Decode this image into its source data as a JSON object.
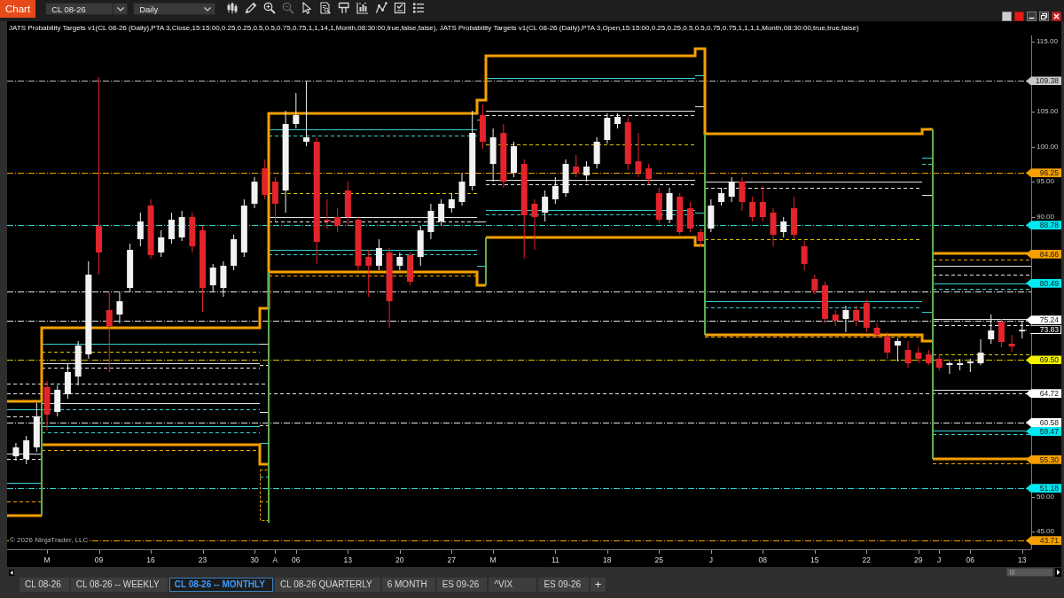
{
  "window": {
    "title": "Chart"
  },
  "toolbar": {
    "instrument": "CL 08-26",
    "interval": "Daily",
    "tools": [
      {
        "kind": "candles",
        "disabled": false
      },
      {
        "kind": "pencil",
        "disabled": false
      },
      {
        "kind": "zoom_in",
        "disabled": false
      },
      {
        "kind": "zoom_out",
        "disabled": true
      },
      {
        "kind": "pointer",
        "disabled": false
      },
      {
        "kind": "properties",
        "disabled": false
      },
      {
        "kind": "flag",
        "disabled": false
      },
      {
        "kind": "indicators",
        "disabled": false
      },
      {
        "kind": "strategies",
        "disabled": false
      },
      {
        "kind": "checklist",
        "disabled": false
      },
      {
        "kind": "list",
        "disabled": false
      }
    ]
  },
  "chart": {
    "legend": "JATS Probability Targets v1(CL 08-26 (Daily),PTA 3,Close,15:15:00,0.25,0.25,0.5,0.5,0.75,0.75,1,1,14,1,Month,08:30:00,true,false,false), JATS Probability Targets v1(CL 08-26 (Daily),PTA 3,Open,15:15:00,0.25,0.25,0.5,0.5,0.75,0.75,1,1,1,1,Month,08:30:00,true,true,false)",
    "chart_data": {
      "type": "candlestick",
      "categories": [
        null,
        null,
        null,
        "M",
        null,
        null,
        null,
        null,
        "09",
        null,
        null,
        null,
        null,
        "16",
        null,
        null,
        null,
        null,
        "23",
        null,
        null,
        null,
        null,
        "30",
        null,
        "A",
        null,
        "06",
        null,
        null,
        null,
        null,
        "13",
        null,
        null,
        null,
        null,
        "20",
        null,
        null,
        null,
        null,
        "27",
        null,
        null,
        null,
        "M",
        null,
        null,
        null,
        null,
        null,
        "11",
        null,
        null,
        null,
        null,
        "18",
        null,
        null,
        null,
        null,
        "25",
        null,
        null,
        null,
        null,
        "J",
        null,
        null,
        null,
        null,
        "08",
        null,
        null,
        null,
        null,
        "15",
        null,
        null,
        null,
        null,
        "22",
        null,
        null,
        null,
        null,
        "29",
        null,
        "J",
        null,
        null,
        "06",
        null,
        null,
        null,
        null,
        "13"
      ],
      "ohlc": [
        [
          55.76,
          57.66,
          55.13,
          57.03
        ],
        [
          55.38,
          58.67,
          54.62,
          58.04
        ],
        [
          57.03,
          63.36,
          56.39,
          61.46
        ],
        [
          65.64,
          66.52,
          59.56,
          61.71
        ],
        [
          62.09,
          65.89,
          61.46,
          65.26
        ],
        [
          64.62,
          69.05,
          63.99,
          67.79
        ],
        [
          67.15,
          72.22,
          65.89,
          71.58
        ],
        [
          70.32,
          83.61,
          69.69,
          81.71
        ],
        [
          88.67,
          109.94,
          81.71,
          84.88
        ],
        [
          76.65,
          79.18,
          67.79,
          74.37
        ],
        [
          76.01,
          79.18,
          74.75,
          77.91
        ],
        [
          79.81,
          86.14,
          79.18,
          85.25
        ],
        [
          86.77,
          90.57,
          85.76,
          89.31
        ],
        [
          91.58,
          92.47,
          83.99,
          84.5
        ],
        [
          84.88,
          88.04,
          84.24,
          87.03
        ],
        [
          86.77,
          90.57,
          86.14,
          89.56
        ],
        [
          87.03,
          90.82,
          86.52,
          89.94
        ],
        [
          89.94,
          90.57,
          84.88,
          85.76
        ],
        [
          88.04,
          88.67,
          76.39,
          79.81
        ],
        [
          80.19,
          83.23,
          79.18,
          82.72
        ],
        [
          79.81,
          83.61,
          78.55,
          82.98
        ],
        [
          82.98,
          87.41,
          82.34,
          86.77
        ],
        [
          84.88,
          92.47,
          84.24,
          91.58
        ],
        [
          91.84,
          95.63,
          91.2,
          95.0
        ],
        [
          96.9,
          98.17,
          92.47,
          93.1
        ],
        [
          95.0,
          95.63,
          89.31,
          91.84
        ],
        [
          93.74,
          105.13,
          90.57,
          103.23
        ],
        [
          103.23,
          107.66,
          102.6,
          104.5
        ],
        [
          100.7,
          109.31,
          100.06,
          101.33
        ],
        [
          100.7,
          101.33,
          83.23,
          86.39
        ],
        [
          89.56,
          92.47,
          88.29,
          89.31
        ],
        [
          89.94,
          91.2,
          87.79,
          88.67
        ],
        [
          93.74,
          95.0,
          88.67,
          89.94
        ],
        [
          89.56,
          89.94,
          82.34,
          82.98
        ],
        [
          84.24,
          85.25,
          78.55,
          82.98
        ],
        [
          82.98,
          86.77,
          82.34,
          85.51
        ],
        [
          84.88,
          85.51,
          74.12,
          77.91
        ],
        [
          82.98,
          84.88,
          82.34,
          84.24
        ],
        [
          84.5,
          84.88,
          80.19,
          80.7
        ],
        [
          84.24,
          88.67,
          82.98,
          88.04
        ],
        [
          87.79,
          91.84,
          86.77,
          90.82
        ],
        [
          89.31,
          92.47,
          88.67,
          91.84
        ],
        [
          91.2,
          93.36,
          90.57,
          92.47
        ],
        [
          92.09,
          96.27,
          91.58,
          95.0
        ],
        [
          94.37,
          105.13,
          93.74,
          101.96
        ],
        [
          104.5,
          106.01,
          99.69,
          100.7
        ],
        [
          97.53,
          102.6,
          95.0,
          101.33
        ],
        [
          101.96,
          103.23,
          94.12,
          95.0
        ],
        [
          96.27,
          100.7,
          95.63,
          100.06
        ],
        [
          97.53,
          98.17,
          83.99,
          90.19
        ],
        [
          91.84,
          92.47,
          85.25,
          89.94
        ],
        [
          90.57,
          93.74,
          89.31,
          92.85
        ],
        [
          92.47,
          95.63,
          91.84,
          94.37
        ],
        [
          93.36,
          98.17,
          92.85,
          97.53
        ],
        [
          97.15,
          98.8,
          95.63,
          96.27
        ],
        [
          95.89,
          97.91,
          95.0,
          97.15
        ],
        [
          97.53,
          101.33,
          96.9,
          100.7
        ],
        [
          100.95,
          104.75,
          100.44,
          104.12
        ],
        [
          103.23,
          104.75,
          102.6,
          104.24
        ],
        [
          103.48,
          104.24,
          96.65,
          97.53
        ],
        [
          97.91,
          101.96,
          95.63,
          96.27
        ],
        [
          96.9,
          97.53,
          94.62,
          95.38
        ],
        [
          93.36,
          94.12,
          89.05,
          89.56
        ],
        [
          89.56,
          94.12,
          89.05,
          93.36
        ],
        [
          92.85,
          93.36,
          87.41,
          87.79
        ],
        [
          91.2,
          92.09,
          87.79,
          88.29
        ],
        [
          87.79,
          88.29,
          85.76,
          86.52
        ],
        [
          88.29,
          92.47,
          87.79,
          91.58
        ],
        [
          92.09,
          94.12,
          91.58,
          93.36
        ],
        [
          92.85,
          95.63,
          92.09,
          95.0
        ],
        [
          95.0,
          95.63,
          90.82,
          92.09
        ],
        [
          92.09,
          92.85,
          89.31,
          89.94
        ],
        [
          92.09,
          94.37,
          89.31,
          89.94
        ],
        [
          90.57,
          91.2,
          85.76,
          87.41
        ],
        [
          87.79,
          89.94,
          87.03,
          89.31
        ],
        [
          91.2,
          92.85,
          86.77,
          87.41
        ],
        [
          85.76,
          86.52,
          82.34,
          83.23
        ],
        [
          81.08,
          81.71,
          78.93,
          79.43
        ],
        [
          80.19,
          80.7,
          74.75,
          75.38
        ],
        [
          76.01,
          76.65,
          74.37,
          75.13
        ],
        [
          75.38,
          77.28,
          73.48,
          76.65
        ],
        [
          76.65,
          77.28,
          74.37,
          75.13
        ],
        [
          77.66,
          78.17,
          73.48,
          74.12
        ],
        [
          74.12,
          74.75,
          72.6,
          73.1
        ],
        [
          72.85,
          73.48,
          69.69,
          70.57
        ],
        [
          71.58,
          72.6,
          69.31,
          72.22
        ],
        [
          70.95,
          72.22,
          68.42,
          69.05
        ],
        [
          70.57,
          71.33,
          69.05,
          69.69
        ],
        [
          70.32,
          70.95,
          68.8,
          69.05
        ],
        [
          69.69,
          70.32,
          68.04,
          68.42
        ],
        [
          68.8,
          69.31,
          67.53,
          69.05
        ],
        [
          68.8,
          69.69,
          68.04,
          69.05
        ],
        [
          69.05,
          69.69,
          67.79,
          69.31
        ],
        [
          69.05,
          72.47,
          68.8,
          70.57
        ],
        [
          72.47,
          76.01,
          71.84,
          73.74
        ],
        [
          75.0,
          75.38,
          71.33,
          72.09
        ],
        [
          71.84,
          73.1,
          70.7,
          71.46
        ],
        [
          73.6,
          75.13,
          72.6,
          73.83
        ]
      ],
      "ylim": [
        42.47,
        115.89
      ],
      "yticks": [
        {
          "value": 115,
          "label": "115.00"
        },
        {
          "value": 105,
          "label": "105.00"
        },
        {
          "value": 100,
          "label": "100.00"
        },
        {
          "value": 95,
          "label": "95.00"
        },
        {
          "value": 90,
          "label": "90.00"
        },
        {
          "value": 50,
          "label": "50.00"
        },
        {
          "value": 45,
          "label": "45.00"
        }
      ]
    },
    "price_markers": [
      {
        "label": "109.38",
        "color": "#c8c8c8"
      },
      {
        "label": "96.25",
        "color": "#f5a000"
      },
      {
        "label": "88.78",
        "color": "#00e8f0"
      },
      {
        "label": "84.66",
        "color": "#f5a000"
      },
      {
        "label": "80.49",
        "color": "#00e8f0"
      },
      {
        "label": "75.24",
        "color": "#ffffff"
      },
      {
        "label": "73.83",
        "color": "#000000"
      },
      {
        "label": "69.50",
        "color": "#f2f200"
      },
      {
        "label": "64.72",
        "color": "#ffffff"
      },
      {
        "label": "60.58",
        "color": "#ffffff"
      },
      {
        "label": "59.47",
        "color": "#00e8f0"
      },
      {
        "label": "55.30",
        "color": "#f5a000"
      },
      {
        "label": "51.18",
        "color": "#00e8f0"
      },
      {
        "label": "43.71",
        "color": "#f5a000"
      }
    ],
    "copyright": "© 2026 NinjaTrader, LLC"
  },
  "tabs": [
    {
      "label": "CL 08-26",
      "selected": false
    },
    {
      "label": "CL 08-26 -- WEEKLY",
      "selected": false
    },
    {
      "label": "CL 08-26 -- MONTHLY",
      "selected": true
    },
    {
      "label": "CL 08-26 QUARTERLY",
      "selected": false
    },
    {
      "label": "6 MONTH",
      "selected": false
    },
    {
      "label": "ES 09-26",
      "selected": false
    },
    {
      "label": "^VIX",
      "selected": false
    },
    {
      "label": "ES 09-26",
      "selected": false
    }
  ],
  "new_tab": "+"
}
